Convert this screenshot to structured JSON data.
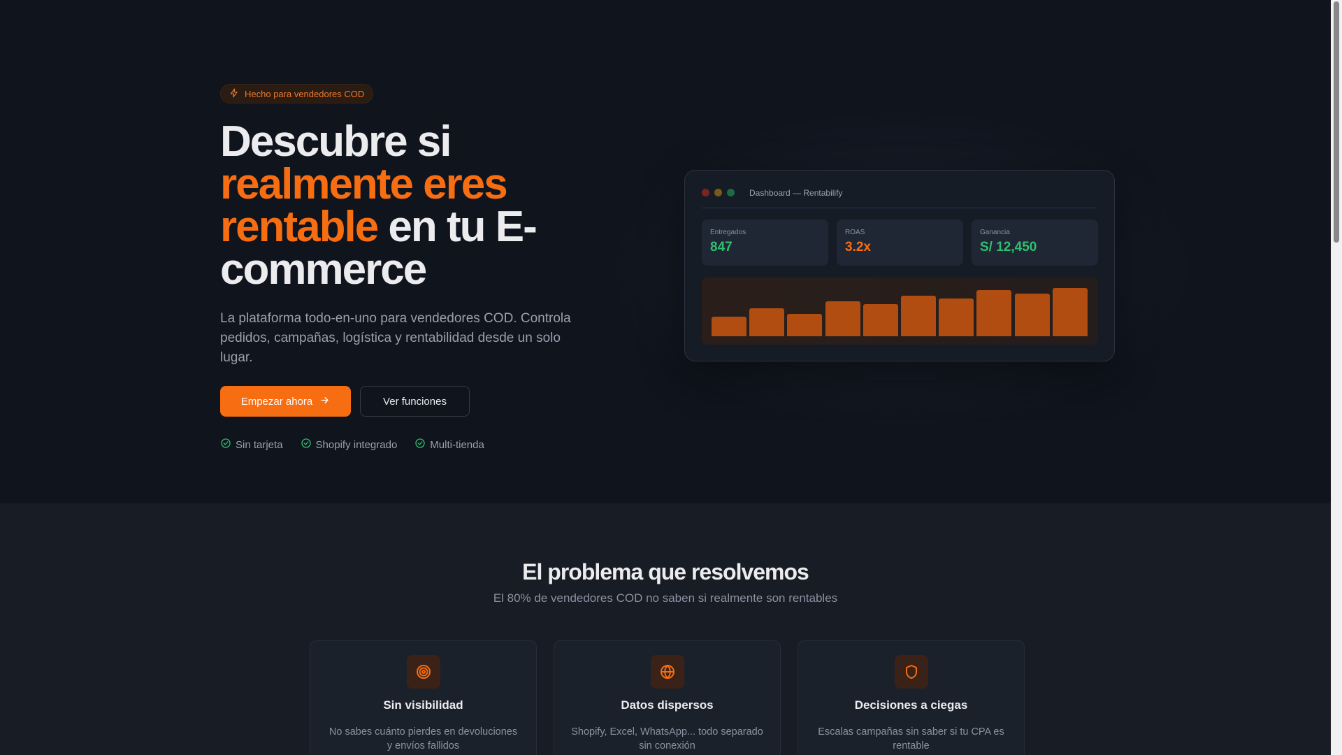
{
  "hero": {
    "badge": "Hecho para vendedores COD",
    "headline_line1": "Descubre si",
    "headline_accent1": "realmente eres",
    "headline_accent2": "rentable",
    "headline_rest": " en tu E-",
    "headline_line4": "commerce",
    "subtitle": "La plataforma todo-en-uno para vendedores COD. Controla pedidos, campañas, logística y rentabilidad desde un solo lugar.",
    "primary_button": "Empezar ahora",
    "secondary_button": "Ver funciones",
    "checks": [
      "Sin tarjeta",
      "Shopify integrado",
      "Multi-tienda"
    ]
  },
  "dashboard": {
    "title": "Dashboard — Rentabilify",
    "window_dots": [
      "#7a2424",
      "#7a5a17",
      "#1b6b45"
    ],
    "stats": [
      {
        "label": "Entregados",
        "value": "847",
        "color": "#2fbf71"
      },
      {
        "label": "ROAS",
        "value": "3.2x",
        "color": "#f76d12"
      },
      {
        "label": "Ganancia",
        "value": "S/ 12,450",
        "color": "#2fbf71"
      }
    ],
    "bar_levels": [
      0.35,
      0.5,
      0.4,
      0.62,
      0.58,
      0.72,
      0.68,
      0.82,
      0.76,
      0.86
    ],
    "bar_color": "#b14d10"
  },
  "problem": {
    "title": "El problema que resolvemos",
    "subtitle": "El 80% de vendedores COD no saben si realmente son rentables",
    "cards": [
      {
        "icon": "target-icon",
        "title": "Sin visibilidad",
        "desc": "No sabes cuánto pierdes en devoluciones y envíos fallidos"
      },
      {
        "icon": "globe-icon",
        "title": "Datos dispersos",
        "desc": "Shopify, Excel, WhatsApp... todo separado sin conexión"
      },
      {
        "icon": "shield-icon",
        "title": "Decisiones a ciegas",
        "desc": "Escalas campañas sin saber si tu CPA es rentable"
      }
    ]
  },
  "colors": {
    "accent": "#f76d12",
    "success": "#2fbf71",
    "background": "#0f141d"
  }
}
